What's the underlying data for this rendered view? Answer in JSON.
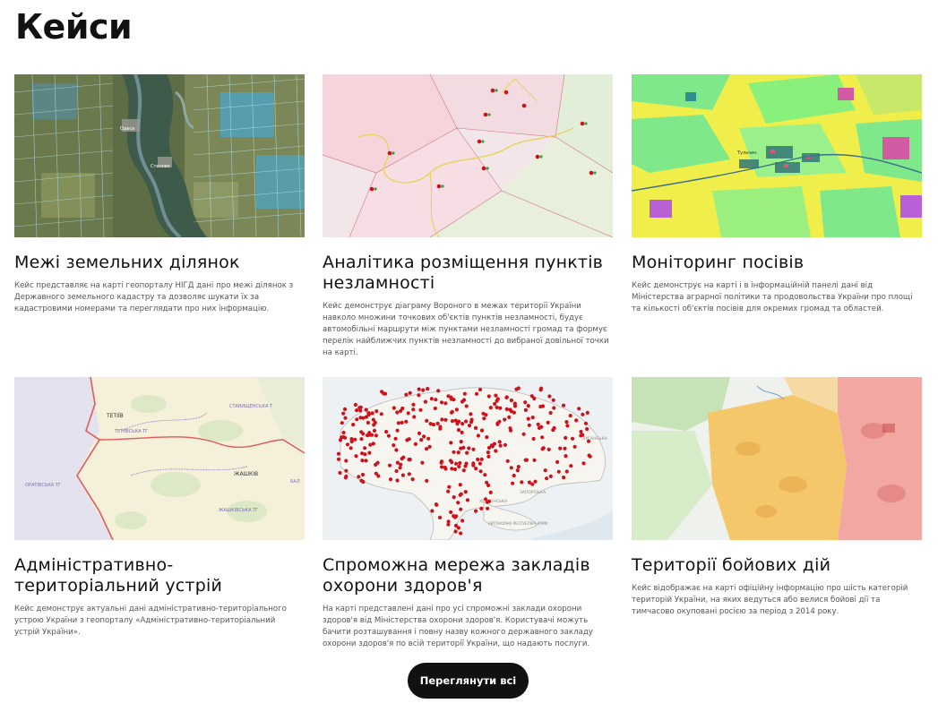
{
  "page": {
    "title": "Кейси"
  },
  "cases": [
    {
      "title": "Межі земельних ділянок",
      "description": "Кейс представляє на карті геопорталу НІГД дані про межі ділянок з Державного земельного кадастру та дозволяє шукати їх за кадастровими номерами та переглядати про них інформацію.",
      "map_labels": [
        "Одеса",
        "Степове"
      ]
    },
    {
      "title": "Аналітика розміщення пунктів незламності",
      "description": "Кейс демонструє діаграму Вороного в межах території України навколо множини точкових об'єктів пунктів незламності, будує автомобільні маршрути між пунктами незламності громад та формує перелік найближчих пунктів незламності до вибраної довільної точки на карті."
    },
    {
      "title": "Моніторинг посівів",
      "description": "Кейс демонструє на карті і в інформаційній панелі дані від Міністерства аграрної політики та продовольства України про площі та кількості об'єктів посівів для окремих громад та областей.",
      "map_labels": [
        "Тульчин"
      ]
    },
    {
      "title": "Адміністративно-територіальний устрій",
      "description": "Кейс демонструє актуальні дані адміністративно-територіального устрою України з геопорталу «Адміністративно-територіальний устрій України».",
      "map_labels": [
        "ТЕТІЇВ",
        "ТЕТІЇВСЬКА ТГ",
        "СТАВИЩЕНСЬКА Т",
        "ЖАШКІВ",
        "ЖАШКІВСЬКА ТГ",
        "ОРАТІВСЬКА ТГ",
        "БАЛ"
      ]
    },
    {
      "title": "Спроможна мережа закладів охорони здоров'я",
      "description": "На карті представлені дані про усі спроможні заклади охорони здоров'я від Міністерства охорони здоров'я. Користувачі можуть бачити розташування і повну назву кожного державного закладу охорони здоров'я по всій території України, що надають послуги.",
      "map_labels": [
        "ЛУГАНСЬКА",
        "ЗАПОРІЗЬКА",
        "ХЕРСОНСЬКА",
        "АВТОНОМНА РЕСПУБЛІКА КРИМ"
      ]
    },
    {
      "title": "Території бойових дій",
      "description": "Кейс відображає на карті офіційну інформацію про шість категорій територій України, на яких ведуться або велися бойові дії та тимчасово окуповані росією за період з 2014 року."
    }
  ],
  "actions": {
    "view_all_label": "Переглянути всі"
  },
  "colors": {
    "button_bg": "#111111",
    "button_text": "#ffffff",
    "title_text": "#111111",
    "desc_text": "#555555",
    "marker_red": "#d0111b"
  }
}
